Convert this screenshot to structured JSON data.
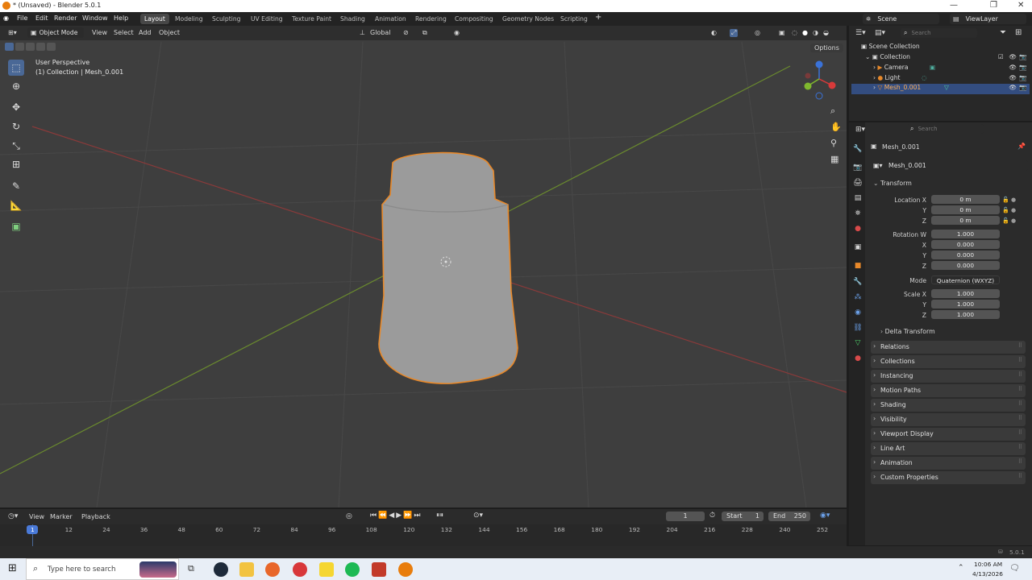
{
  "window": {
    "title": "* (Unsaved) - Blender 5.0.1"
  },
  "menu": {
    "file": "File",
    "edit": "Edit",
    "render": "Render",
    "window": "Window",
    "help": "Help"
  },
  "workspaces": [
    "Layout",
    "Modeling",
    "Sculpting",
    "UV Editing",
    "Texture Paint",
    "Shading",
    "Animation",
    "Rendering",
    "Compositing",
    "Geometry Nodes",
    "Scripting"
  ],
  "add_workspace": "+",
  "scene": {
    "label": "Scene",
    "view_layer": "ViewLayer"
  },
  "viewport_header": {
    "mode": "Object Mode",
    "view": "View",
    "select": "Select",
    "add": "Add",
    "object": "Object",
    "orientation": "Global",
    "options": "Options"
  },
  "viewport": {
    "perspective": "User Perspective",
    "collection_info": "(1) Collection | Mesh_0.001"
  },
  "outliner": {
    "search_placeholder": "Search",
    "scene_collection": "Scene Collection",
    "collection": "Collection",
    "items": [
      "Camera",
      "Light",
      "Mesh_0.001"
    ]
  },
  "properties": {
    "search_placeholder": "Search",
    "object_name": "Mesh_0.001",
    "data_name": "Mesh_0.001",
    "transform_title": "Transform",
    "location_label": "Location X",
    "y_label": "Y",
    "z_label": "Z",
    "x_label": "X",
    "w_label": "Rotation W",
    "mode_label": "Mode",
    "scale_label": "Scale X",
    "location": [
      "0 m",
      "0 m",
      "0 m"
    ],
    "rotation": [
      "1.000",
      "0.000",
      "0.000",
      "0.000"
    ],
    "rotation_mode": "Quaternion (WXYZ)",
    "scale": [
      "1.000",
      "1.000",
      "1.000"
    ],
    "delta": "Delta Transform",
    "panels": [
      "Relations",
      "Collections",
      "Instancing",
      "Motion Paths",
      "Shading",
      "Visibility",
      "Viewport Display",
      "Line Art",
      "Animation",
      "Custom Properties"
    ]
  },
  "timeline": {
    "view": "View",
    "marker": "Marker",
    "playback": "Playback",
    "current_frame": "1",
    "start_label": "Start",
    "start": "1",
    "end_label": "End",
    "end": "250",
    "ticks": [
      "1",
      "12",
      "24",
      "36",
      "48",
      "60",
      "72",
      "84",
      "96",
      "108",
      "120",
      "132",
      "144",
      "156",
      "168",
      "180",
      "192",
      "204",
      "216",
      "228",
      "240",
      "252"
    ]
  },
  "status": {
    "version": "5.0.1"
  },
  "taskbar": {
    "search_placeholder": "Type here to search",
    "time": "10:06 AM",
    "date": "4/13/2026"
  },
  "colors": {
    "accent": "#4a6896",
    "selection": "#e8892a",
    "viewport_bg": "#3e3e3e"
  }
}
